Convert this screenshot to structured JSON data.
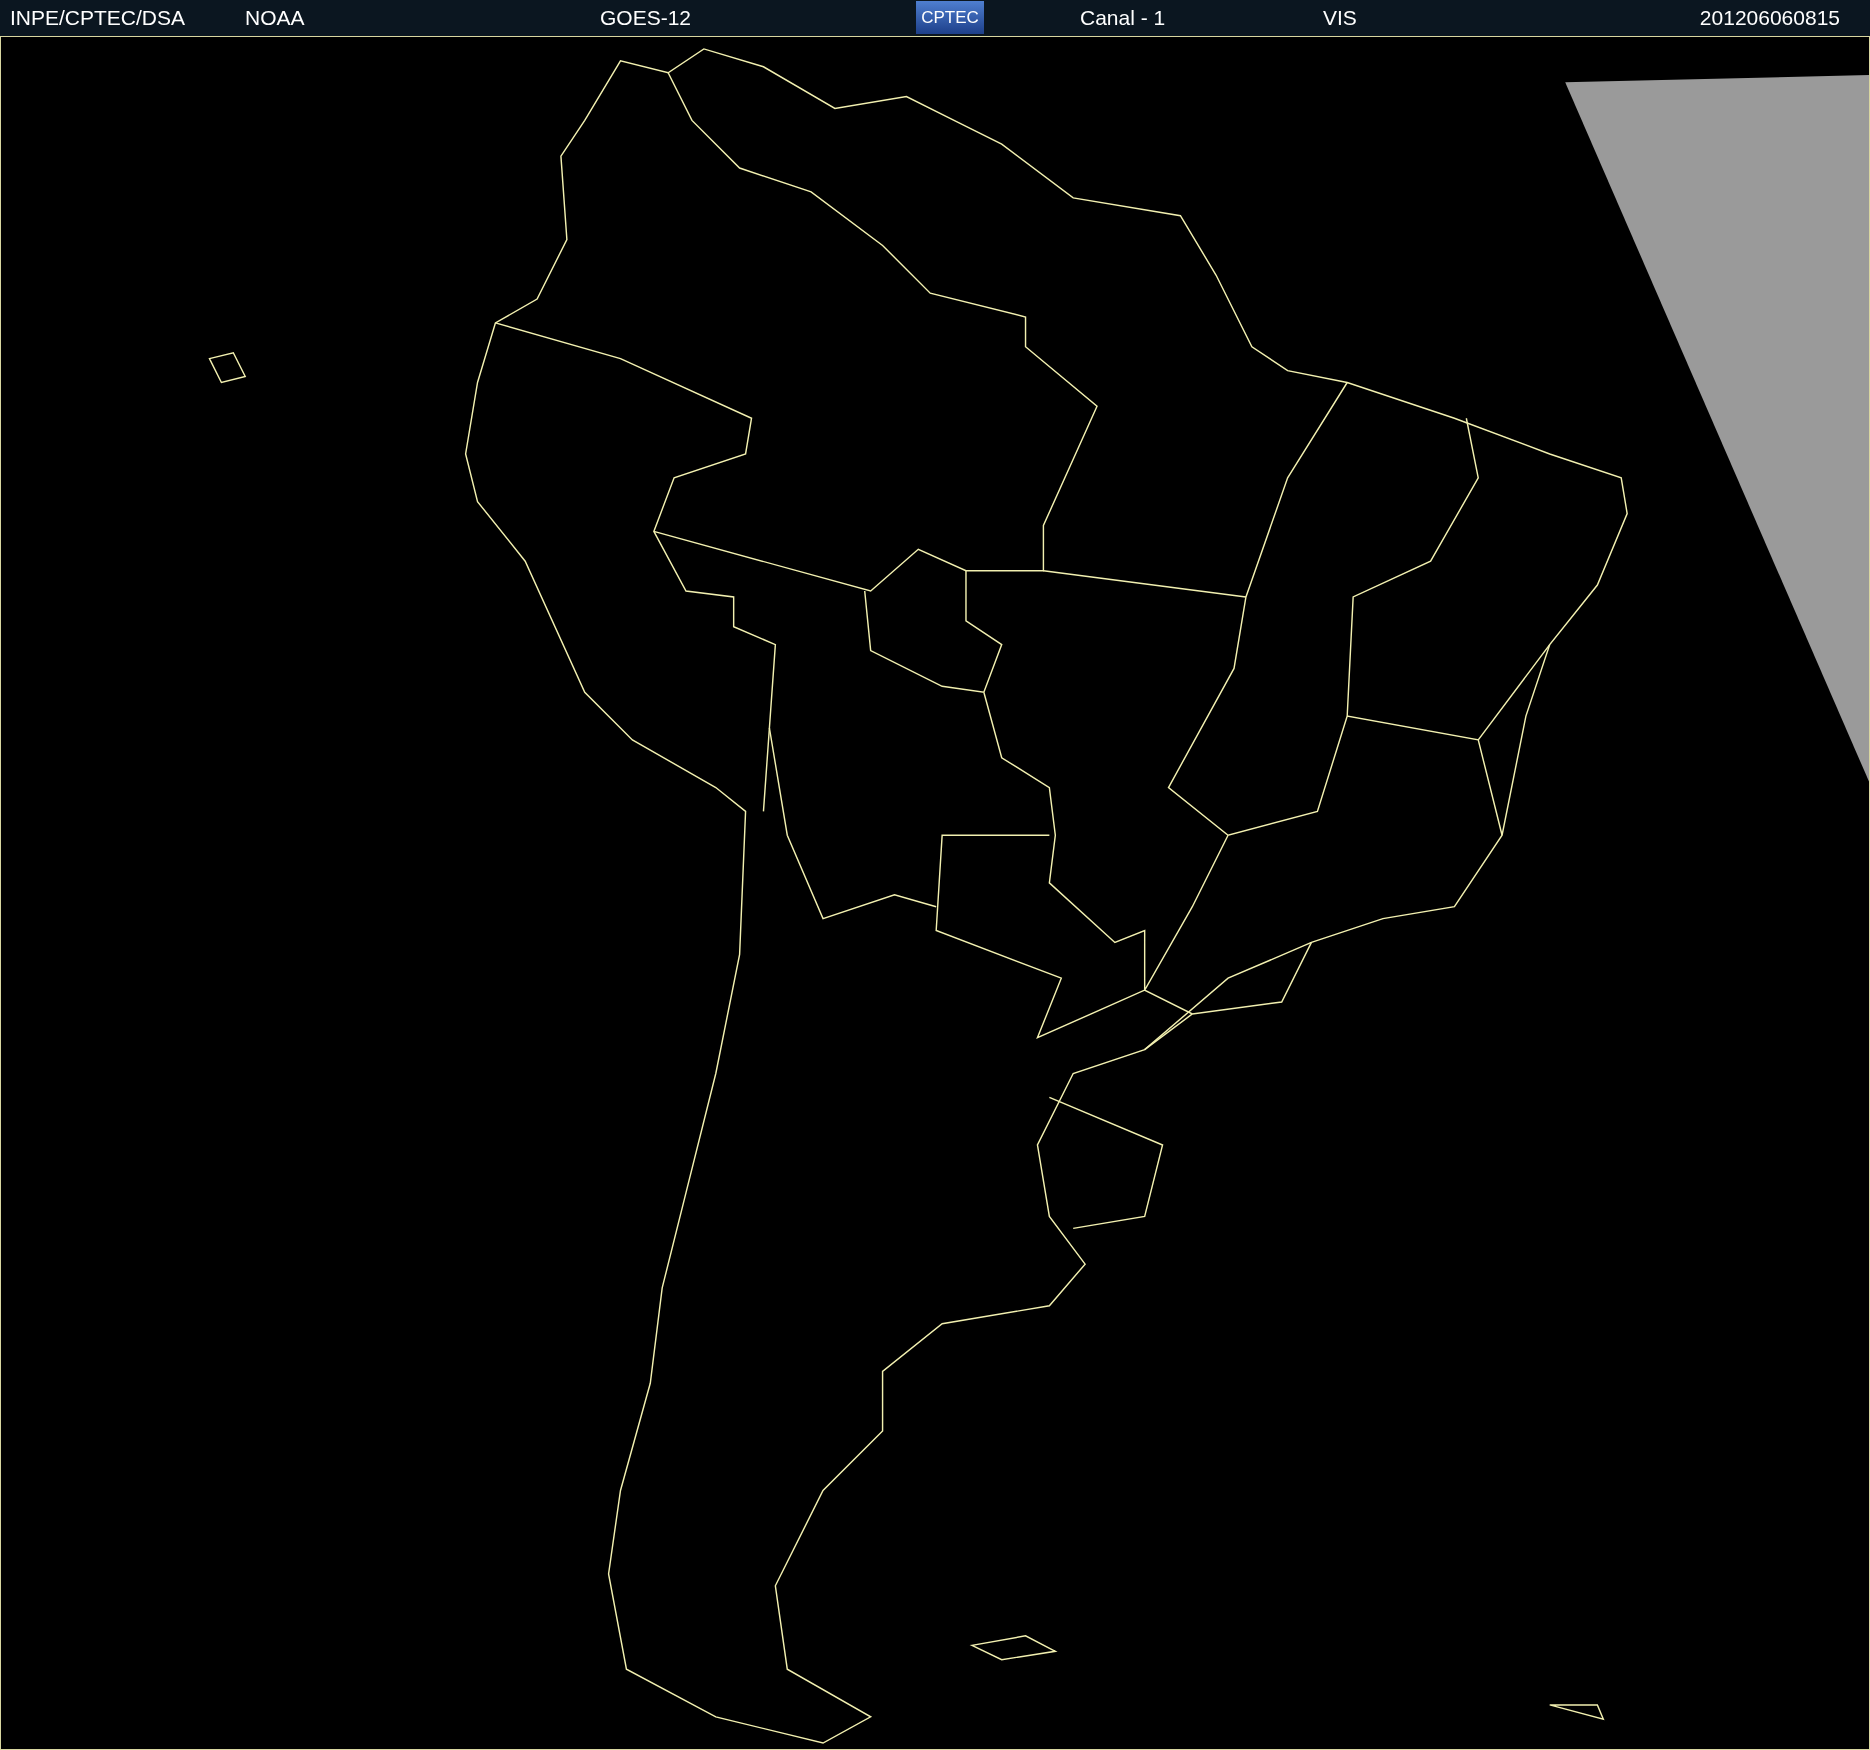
{
  "header": {
    "source": "INPE/CPTEC/DSA",
    "agency": "NOAA",
    "satellite": "GOES-12",
    "logo": "CPTEC",
    "channel": "Canal - 1",
    "band": "VIS",
    "timestamp": "201206060815"
  }
}
